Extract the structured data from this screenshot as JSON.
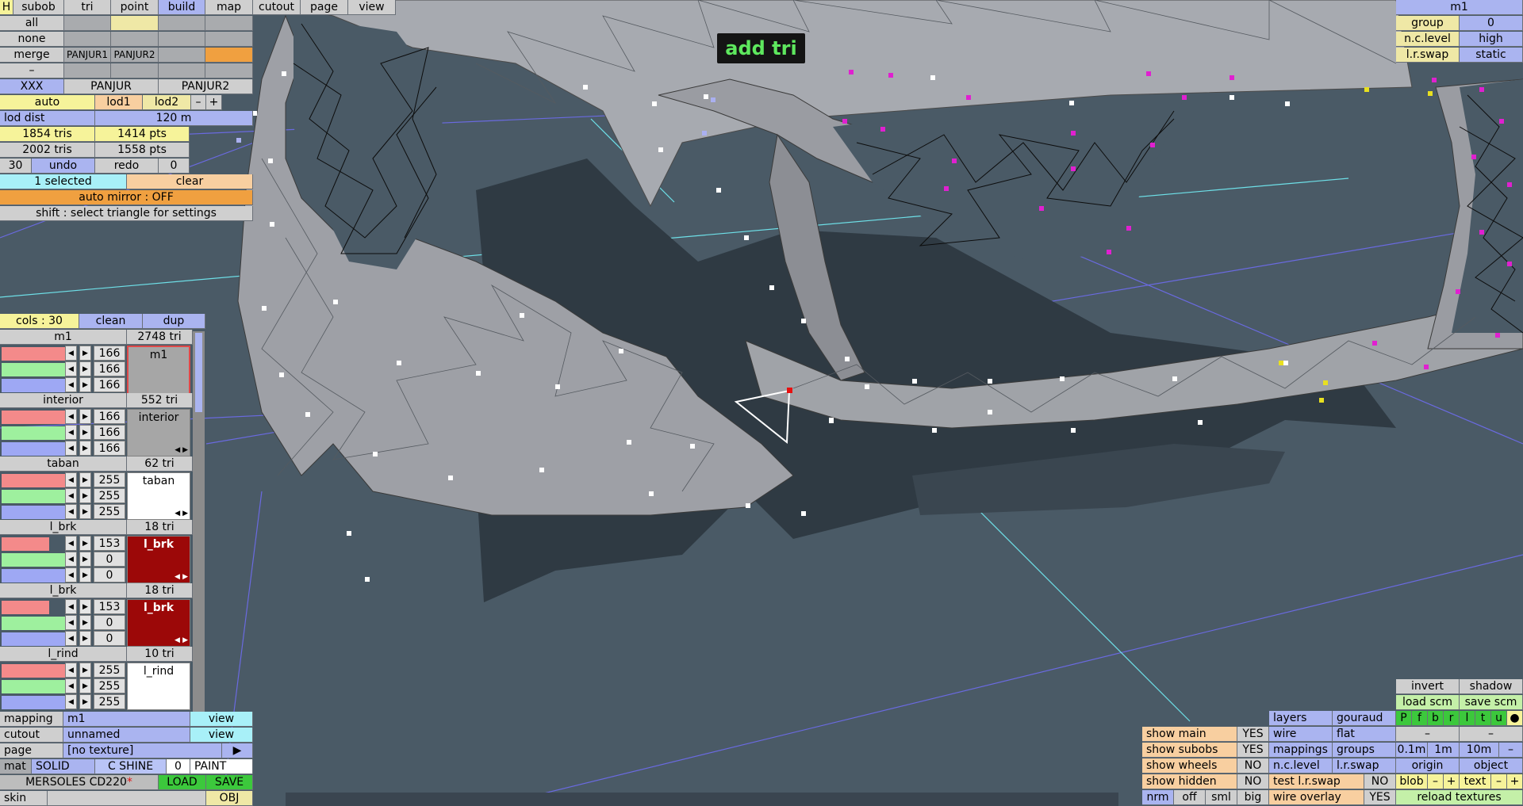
{
  "menu": {
    "h": "H",
    "subob": "subob",
    "tri": "tri",
    "point": "point",
    "build": "build",
    "map": "map",
    "cutout": "cutout",
    "page": "page",
    "view": "view"
  },
  "sel": {
    "all": "all",
    "none": "none",
    "merge": "merge",
    "panjur1": "PANJUR1",
    "panjur2": "PANJUR2",
    "dash": "–"
  },
  "objs": {
    "xxx": "XXX",
    "panjur": "PANJUR",
    "panjur2": "PANJUR2"
  },
  "lod": {
    "auto": "auto",
    "lod1": "lod1",
    "lod2": "lod2",
    "minus": "–",
    "plus": "+",
    "dist_label": "lod dist",
    "dist_value": "120 m"
  },
  "stats": {
    "tris1": "1854 tris",
    "pts1": "1414 pts",
    "tris2": "2002 tris",
    "pts2": "1558 pts"
  },
  "undo": {
    "count": "30",
    "undo": "undo",
    "redo": "redo",
    "redo_count": "0"
  },
  "selection": {
    "selected": "1 selected",
    "clear": "clear",
    "mirror": "auto mirror : OFF",
    "hint": "shift : select triangle for settings"
  },
  "cols": {
    "cols": "cols : 30",
    "clean": "clean",
    "dup": "dup"
  },
  "materials": [
    {
      "name": "m1",
      "tris": "2748 tri",
      "r": "166",
      "g": "166",
      "b": "166",
      "label": "m1",
      "color": "#a6a6a6"
    },
    {
      "name": "interior",
      "tris": "552 tri",
      "r": "166",
      "g": "166",
      "b": "166",
      "label": "interior",
      "color": "#a6a6a6"
    },
    {
      "name": "taban",
      "tris": "62 tri",
      "r": "255",
      "g": "255",
      "b": "255",
      "label": "taban",
      "color": "#ffffff"
    },
    {
      "name": "l_brk",
      "tris": "18 tri",
      "r": "153",
      "g": "0",
      "b": "0",
      "label": "l_brk",
      "color": "#990000"
    },
    {
      "name": "l_brk",
      "tris": "18 tri",
      "r": "153",
      "g": "0",
      "b": "0",
      "label": "l_brk",
      "color": "#990000"
    },
    {
      "name": "l_rind",
      "tris": "10 tri",
      "r": "255",
      "g": "255",
      "b": "255",
      "label": "l_rind",
      "color": "#ffffff"
    }
  ],
  "bottom_left": {
    "mapping": "mapping",
    "mapping_val": "m1",
    "view": "view",
    "cutout": "cutout",
    "cutout_val": "unnamed",
    "page": "page",
    "page_val": "[no texture]",
    "play": "▶",
    "mat": "mat",
    "solid": "SOLID",
    "cshine": "C SHINE",
    "zero": "0",
    "paint": "PAINT",
    "model": "MERSOLES CD220",
    "star": "*",
    "load": "LOAD",
    "save": "SAVE",
    "skin": "skin",
    "obj": "OBJ"
  },
  "top_right": {
    "title": "m1",
    "group": "group",
    "group_val": "0",
    "nclevel": "n.c.level",
    "nclevel_val": "high",
    "lrswap": "l.r.swap",
    "lrswap_val": "static"
  },
  "tooltip": "add tri",
  "br": {
    "invert": "invert",
    "shadow": "shadow",
    "load_scm": "load scm",
    "save_scm": "save scm",
    "layers": "layers",
    "gouraud": "gouraud",
    "pfbr": [
      "P",
      "f",
      "b",
      "r",
      "l",
      "t",
      "u",
      "●"
    ],
    "wire": "wire",
    "flat": "flat",
    "dash": "–",
    "show_main": "show main",
    "yes1": "YES",
    "mappings": "mappings",
    "groups": "groups",
    "d01": "0.1m",
    "d1": "1m",
    "d10": "10m",
    "show_subobs": "show subobs",
    "yes2": "YES",
    "nclevel": "n.c.level",
    "lrswap": "l.r.swap",
    "origin": "origin",
    "object": "object",
    "show_wheels": "show wheels",
    "no1": "NO",
    "test_lr": "test l.r.swap",
    "no3": "NO",
    "blob": "blob",
    "minus": "–",
    "plus": "+",
    "text": "text",
    "show_hidden": "show hidden",
    "no2": "NO",
    "wire_overlay": "wire overlay",
    "yes3": "YES",
    "reload": "reload textures",
    "nrm": "nrm",
    "off": "off",
    "sml": "sml",
    "big": "big"
  }
}
